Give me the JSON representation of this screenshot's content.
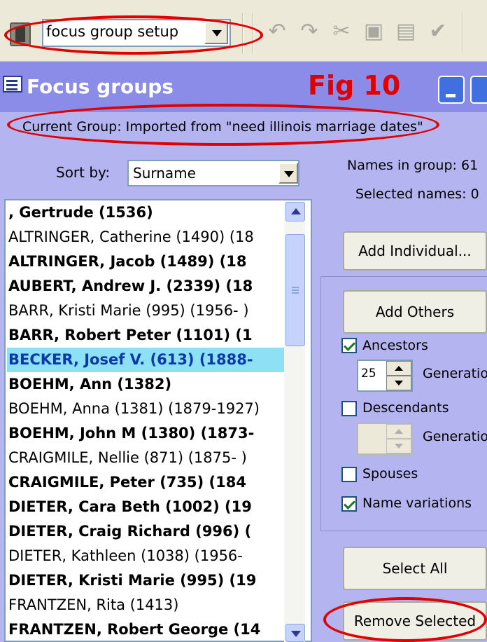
{
  "toolbar": {
    "group_combo_value": "focus group setup"
  },
  "window": {
    "title": "Focus groups",
    "annotation_label": "Fig 10"
  },
  "group_info": {
    "current_group": "Current Group:  Imported from \"need illinois marriage dates\"",
    "sort_by_label": "Sort by:",
    "sort_by_value": "Surname",
    "names_in_group": "Names in group: 61",
    "selected_names": "Selected names: 0"
  },
  "names": [
    {
      "text": ", Gertrude (1536)",
      "bold": true,
      "selected": false
    },
    {
      "text": "ALTRINGER, Catherine (1490) (18",
      "bold": false,
      "selected": false
    },
    {
      "text": "ALTRINGER, Jacob (1489) (18",
      "bold": true,
      "selected": false
    },
    {
      "text": "AUBERT, Andrew J. (2339) (18",
      "bold": true,
      "selected": false
    },
    {
      "text": "BARR, Kristi Marie (995) (1956-  )",
      "bold": false,
      "selected": false
    },
    {
      "text": "BARR, Robert Peter (1101) (1",
      "bold": true,
      "selected": false
    },
    {
      "text": "BECKER, Josef V. (613) (1888-",
      "bold": true,
      "selected": true
    },
    {
      "text": "BOEHM, Ann (1382)",
      "bold": true,
      "selected": false
    },
    {
      "text": "BOEHM, Anna (1381) (1879-1927)",
      "bold": false,
      "selected": false
    },
    {
      "text": "BOEHM, John M (1380) (1873-",
      "bold": true,
      "selected": false
    },
    {
      "text": "CRAIGMILE, Nellie (871) (1875-  )",
      "bold": false,
      "selected": false
    },
    {
      "text": "CRAIGMILE, Peter (735) (184",
      "bold": true,
      "selected": false
    },
    {
      "text": "DIETER, Cara Beth (1002) (19",
      "bold": true,
      "selected": false
    },
    {
      "text": "DIETER, Craig Richard (996) (",
      "bold": true,
      "selected": false
    },
    {
      "text": "DIETER, Kathleen (1038) (1956-",
      "bold": false,
      "selected": false
    },
    {
      "text": "DIETER, Kristi Marie (995) (19",
      "bold": true,
      "selected": false
    },
    {
      "text": "FRANTZEN, Rita (1413)",
      "bold": false,
      "selected": false
    },
    {
      "text": "FRANTZEN, Robert George (14",
      "bold": true,
      "selected": false
    }
  ],
  "actions": {
    "add_individual": "Add Individual...",
    "add_others": "Add Others",
    "select_all": "Select All",
    "remove_selected": "Remove Selected"
  },
  "options": {
    "ancestors_label": "Ancestors",
    "ancestors_checked": true,
    "ancestor_generations_value": "25",
    "generations_label": "Generations",
    "descendants_label": "Descendants",
    "descendants_checked": false,
    "spouses_label": "Spouses",
    "spouses_checked": false,
    "name_variations_label": "Name variations",
    "name_variations_checked": true
  },
  "colors": {
    "window_bg": "#b4b4f0",
    "title_bar": "#8a8ce8",
    "annotation": "#e00000",
    "selection": "#8ee0f4"
  }
}
